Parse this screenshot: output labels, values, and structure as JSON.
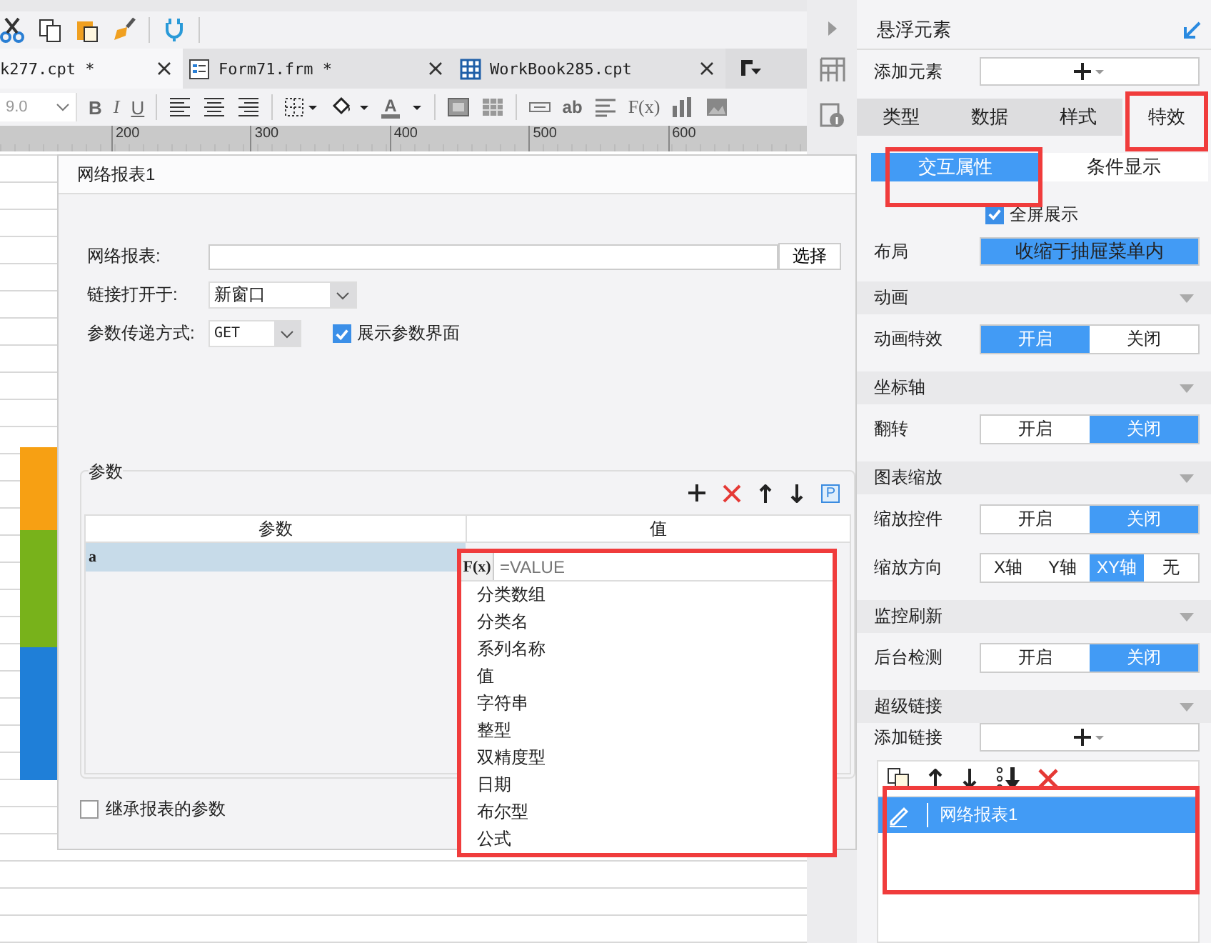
{
  "tabs": [
    {
      "label": "k277.cpt *",
      "selected": true,
      "kind": "report"
    },
    {
      "label": "Form71.frm *",
      "selected": false,
      "kind": "form"
    },
    {
      "label": "WorkBook285.cpt",
      "selected": false,
      "kind": "workbook"
    }
  ],
  "format_bar": {
    "font_size": "9.0",
    "bold": "B",
    "italic": "I",
    "underline": "U",
    "font_color": "A",
    "text_tool": "ab",
    "formula": "F(x)"
  },
  "ruler": {
    "ticks": [
      "200",
      "300",
      "400",
      "500",
      "600"
    ]
  },
  "dialog": {
    "title": "网络报表1",
    "report": {
      "label": "网络报表:",
      "button": "选择"
    },
    "open_in": {
      "label": "链接打开于:",
      "value": "新窗口"
    },
    "method": {
      "label": "参数传递方式:",
      "value": "GET"
    },
    "show_params": {
      "label": "展示参数界面",
      "checked": true
    },
    "params": {
      "title": "参数",
      "glyph": "P",
      "columns": [
        "参数",
        "值"
      ],
      "rows": [
        {
          "name": "a",
          "selected": true
        }
      ]
    },
    "value_editor": {
      "button": "F(x)",
      "placeholder": "=VALUE",
      "options": [
        "分类数组",
        "分类名",
        "系列名称",
        "值",
        "字符串",
        "整型",
        "双精度型",
        "日期",
        "布尔型",
        "公式"
      ]
    },
    "inherit": {
      "label": "继承报表的参数",
      "checked": false
    }
  },
  "panel": {
    "title": "悬浮元素",
    "add_element": {
      "label": "添加元素"
    },
    "tabs": [
      {
        "label": "类型",
        "selected": false
      },
      {
        "label": "数据",
        "selected": false
      },
      {
        "label": "样式",
        "selected": false
      },
      {
        "label": "特效",
        "selected": true
      }
    ],
    "subtabs": [
      {
        "label": "交互属性",
        "selected": true
      },
      {
        "label": "条件显示",
        "selected": false
      }
    ],
    "fullscreen": {
      "label": "全屏展示",
      "checked": true
    },
    "layout": {
      "label": "布局",
      "value": "收缩于抽屉菜单内"
    },
    "sections": [
      {
        "title": "动画",
        "rows": [
          {
            "label": "动画特效",
            "options": [
              {
                "label": "开启",
                "selected": true
              },
              {
                "label": "关闭",
                "selected": false
              }
            ]
          }
        ]
      },
      {
        "title": "坐标轴",
        "rows": [
          {
            "label": "翻转",
            "options": [
              {
                "label": "开启",
                "selected": false
              },
              {
                "label": "关闭",
                "selected": true
              }
            ]
          }
        ]
      },
      {
        "title": "图表缩放",
        "rows": [
          {
            "label": "缩放控件",
            "options": [
              {
                "label": "开启",
                "selected": false
              },
              {
                "label": "关闭",
                "selected": true
              }
            ]
          },
          {
            "label": "缩放方向",
            "options": [
              {
                "label": "X轴",
                "selected": false
              },
              {
                "label": "Y轴",
                "selected": false
              },
              {
                "label": "XY轴",
                "selected": true
              },
              {
                "label": "无",
                "selected": false
              }
            ]
          }
        ]
      },
      {
        "title": "监控刷新",
        "rows": [
          {
            "label": "后台检测",
            "options": [
              {
                "label": "开启",
                "selected": false
              },
              {
                "label": "关闭",
                "selected": true
              }
            ]
          }
        ]
      },
      {
        "title": "超级链接"
      }
    ],
    "add_link": {
      "label": "添加链接"
    },
    "links": [
      {
        "label": "网络报表1",
        "selected": true
      }
    ]
  }
}
